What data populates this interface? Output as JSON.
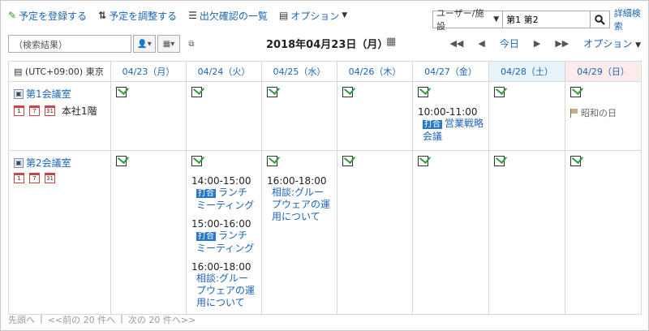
{
  "toolbar": {
    "register": "予定を登録する",
    "adjust": "予定を調整する",
    "attendance": "出欠確認の一覧",
    "options": "オプション"
  },
  "search": {
    "scope": "ユーザー/施設",
    "value": "第1 第2",
    "advanced": "詳細検索"
  },
  "results": {
    "label": "（検索結果）"
  },
  "header": {
    "date": "2018年04月23日（月）",
    "today": "今日",
    "options": "オプション"
  },
  "grid": {
    "timezone": "(UTC+09:00) 東京",
    "days": [
      {
        "label": "04/23（月）",
        "type": "weekday"
      },
      {
        "label": "04/24（火）",
        "type": "weekday"
      },
      {
        "label": "04/25（水）",
        "type": "weekday"
      },
      {
        "label": "04/26（木）",
        "type": "weekday"
      },
      {
        "label": "04/27（金）",
        "type": "weekday"
      },
      {
        "label": "04/28（土）",
        "type": "sat"
      },
      {
        "label": "04/29（日）",
        "type": "sun"
      }
    ],
    "rows": [
      {
        "facility": "第1会議室",
        "location": "本社1階",
        "events": {
          "friday": {
            "time": "10:00-11:00",
            "badge": "打合",
            "title": "営業戦略会議"
          },
          "sunday_holiday": "昭和の日"
        }
      },
      {
        "facility": "第2会議室",
        "location": "",
        "events": {
          "tuesday": [
            {
              "time": "14:00-15:00",
              "badge": "打合",
              "title": "ランチミーティング"
            },
            {
              "time": "15:00-16:00",
              "badge": "打合",
              "title": "ランチミーティング"
            },
            {
              "time": "16:00-18:00",
              "badge": "",
              "title": "相談:グループウェアの運用について"
            }
          ],
          "wednesday": [
            {
              "time": "16:00-18:00",
              "badge": "",
              "title": "相談:グループウェアの運用について"
            }
          ]
        }
      }
    ]
  },
  "pager": {
    "first": "先頭へ",
    "prev": "<<前の 20 件へ",
    "next": "次の 20 件へ>>"
  },
  "mini_cals": [
    "1",
    "7",
    "31"
  ]
}
